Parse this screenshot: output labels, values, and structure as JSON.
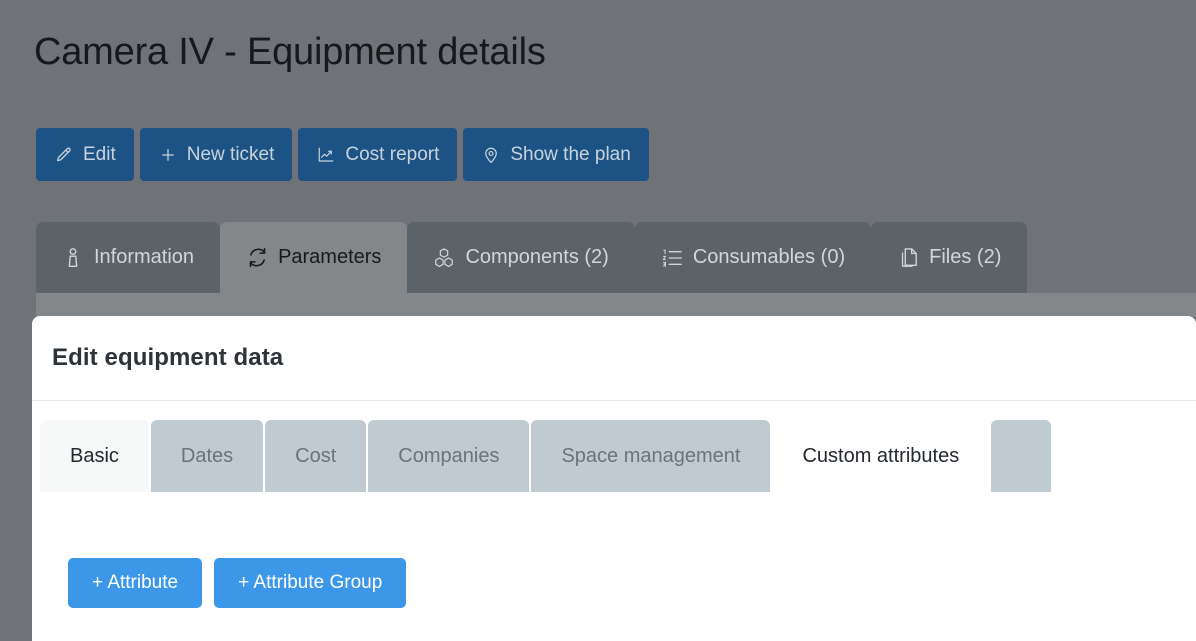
{
  "header": {
    "title": "Camera IV - Equipment details"
  },
  "actions": [
    {
      "label": "Edit",
      "icon": "pencil-icon"
    },
    {
      "label": "New ticket",
      "icon": "plus-icon"
    },
    {
      "label": "Cost report",
      "icon": "chart-line-icon"
    },
    {
      "label": "Show the plan",
      "icon": "map-pin-icon"
    }
  ],
  "tabs": [
    {
      "label": "Information",
      "icon": "info-person-icon",
      "active": false
    },
    {
      "label": "Parameters",
      "icon": "refresh-icon",
      "active": true
    },
    {
      "label": "Components (2)",
      "icon": "cubes-icon",
      "active": false
    },
    {
      "label": "Consumables (0)",
      "icon": "numbered-list-icon",
      "active": false
    },
    {
      "label": "Files (2)",
      "icon": "copy-files-icon",
      "active": false
    }
  ],
  "modal": {
    "title": "Edit equipment data",
    "tabs": [
      {
        "label": "Basic",
        "state": "hover"
      },
      {
        "label": "Dates",
        "state": "inactive"
      },
      {
        "label": "Cost",
        "state": "inactive"
      },
      {
        "label": "Companies",
        "state": "inactive"
      },
      {
        "label": "Space management",
        "state": "inactive"
      },
      {
        "label": "Custom attributes",
        "state": "active"
      },
      {
        "label": "",
        "state": "inactive"
      }
    ],
    "content_actions": [
      {
        "label": "+ Attribute"
      },
      {
        "label": "+ Attribute Group"
      }
    ]
  },
  "colors": {
    "page_background": "#6f7377",
    "action_button": "#1c5384",
    "tab_inactive": "#5c6368",
    "tab_active": "#83878a",
    "inner_tab_inactive": "#bfcad1",
    "primary_blue": "#3d97e8",
    "modal_background": "#ffffff"
  }
}
